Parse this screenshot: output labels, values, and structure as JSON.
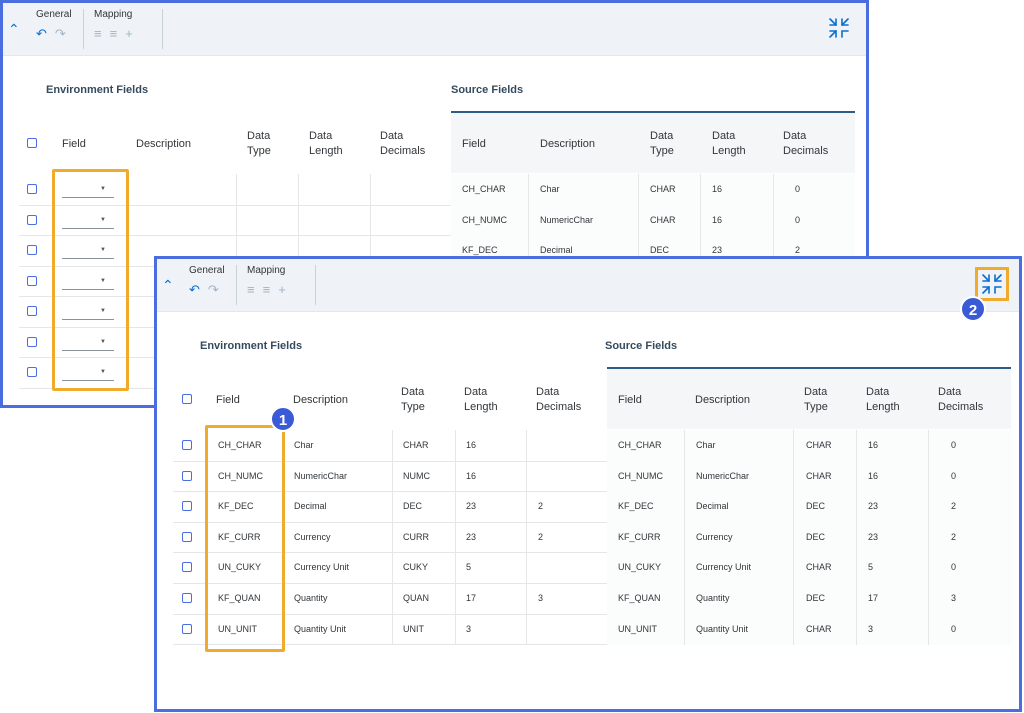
{
  "toolbar": {
    "general_label": "General",
    "mapping_label": "Mapping"
  },
  "sections": {
    "environment_title": "Environment Fields",
    "source_title": "Source Fields"
  },
  "columns": {
    "field": "Field",
    "description": "Description",
    "data_type": [
      "Data",
      "Type"
    ],
    "data_length": [
      "Data",
      "Length"
    ],
    "data_decimals": [
      "Data",
      "Decimals"
    ]
  },
  "back_source_rows": [
    [
      "CH_CHAR",
      "Char",
      "CHAR",
      "16",
      "0"
    ],
    [
      "CH_NUMC",
      "NumericChar",
      "CHAR",
      "16",
      "0"
    ],
    [
      "KF_DEC",
      "Decimal",
      "DEC",
      "23",
      "2"
    ]
  ],
  "front_env_rows": [
    [
      "CH_CHAR",
      "Char",
      "CHAR",
      "16",
      ""
    ],
    [
      "CH_NUMC",
      "NumericChar",
      "NUMC",
      "16",
      ""
    ],
    [
      "KF_DEC",
      "Decimal",
      "DEC",
      "23",
      "2"
    ],
    [
      "KF_CURR",
      "Currency",
      "CURR",
      "23",
      "2"
    ],
    [
      "UN_CUKY",
      "Currency Unit",
      "CUKY",
      "5",
      ""
    ],
    [
      "KF_QUAN",
      "Quantity",
      "QUAN",
      "17",
      "3"
    ],
    [
      "UN_UNIT",
      "Quantity Unit",
      "UNIT",
      "3",
      ""
    ]
  ],
  "front_source_rows": [
    [
      "CH_CHAR",
      "Char",
      "CHAR",
      "16",
      "0"
    ],
    [
      "CH_NUMC",
      "NumericChar",
      "CHAR",
      "16",
      "0"
    ],
    [
      "KF_DEC",
      "Decimal",
      "DEC",
      "23",
      "2"
    ],
    [
      "KF_CURR",
      "Currency",
      "DEC",
      "23",
      "2"
    ],
    [
      "UN_CUKY",
      "Currency Unit",
      "CHAR",
      "5",
      "0"
    ],
    [
      "KF_QUAN",
      "Quantity",
      "DEC",
      "17",
      "3"
    ],
    [
      "UN_UNIT",
      "Quantity Unit",
      "CHAR",
      "3",
      "0"
    ]
  ],
  "back_empty_row_count": 7,
  "callouts": {
    "badge_1": "1",
    "badge_2": "2"
  },
  "colors": {
    "accent": "#0a6ed1",
    "frame": "#4a6ee0",
    "highlight": "#f0ab2c",
    "badge": "#3b5bd6"
  },
  "icons": [
    "collapse-chevron-icon",
    "undo-icon",
    "redo-icon",
    "auto-map-icon",
    "clear-mapping-icon",
    "add-icon",
    "exit-fullscreen-icon"
  ]
}
